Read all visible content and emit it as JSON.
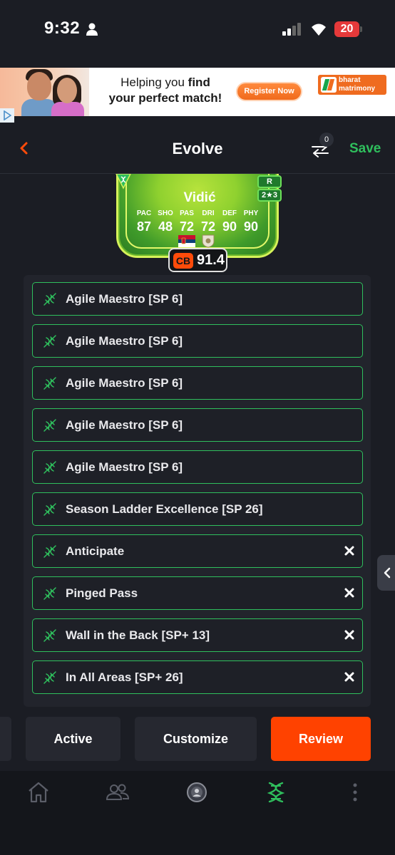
{
  "status_bar": {
    "time": "9:32",
    "battery": "20",
    "colors": {
      "battery": "#e5393a"
    }
  },
  "ad": {
    "headline_line1_prefix": "Helping you ",
    "headline_line1_bold": "find",
    "headline_line2": "your perfect match!",
    "cta": "Register Now",
    "brand_line1": "bharat",
    "brand_line2": "matrimony"
  },
  "header": {
    "title": "Evolve",
    "compare_count": "0",
    "save_label": "Save",
    "colors": {
      "save": "#2fbf5d",
      "back": "#ff4b0a"
    }
  },
  "player_card": {
    "name": "Vidić",
    "rarity_badge": "R",
    "skill_badge": "2★3",
    "stats": [
      {
        "label": "PAC",
        "value": "87"
      },
      {
        "label": "SHO",
        "value": "48"
      },
      {
        "label": "PAS",
        "value": "72"
      },
      {
        "label": "DRI",
        "value": "72"
      },
      {
        "label": "DEF",
        "value": "90"
      },
      {
        "label": "PHY",
        "value": "90"
      }
    ],
    "position": "CB",
    "rating": "91.4",
    "nation_icon": "serbia-flag-icon",
    "club_icon": "club-crest-icon"
  },
  "playstyles": [
    {
      "label": "Agile Maestro [SP 6]",
      "removable": false
    },
    {
      "label": "Agile Maestro [SP 6]",
      "removable": false
    },
    {
      "label": "Agile Maestro [SP 6]",
      "removable": false
    },
    {
      "label": "Agile Maestro [SP 6]",
      "removable": false
    },
    {
      "label": "Agile Maestro [SP 6]",
      "removable": false
    },
    {
      "label": "Season Ladder Excellence [SP 26]",
      "removable": false
    },
    {
      "label": "Anticipate",
      "removable": true
    },
    {
      "label": "Pinged Pass",
      "removable": true
    },
    {
      "label": "Wall in the Back [SP+ 13]",
      "removable": true
    },
    {
      "label": "In All Areas [SP+ 26]",
      "removable": true
    }
  ],
  "actions": {
    "active": "Active",
    "customize": "Customize",
    "review": "Review",
    "colors": {
      "review": "#ff4200"
    }
  },
  "bottom_nav": {
    "items": [
      "home-icon",
      "people-icon",
      "club-icon",
      "dna-icon",
      "more-icon"
    ],
    "active": "dna-icon",
    "colors": {
      "active": "#2fbf5d",
      "inactive": "#5b5e68"
    }
  }
}
